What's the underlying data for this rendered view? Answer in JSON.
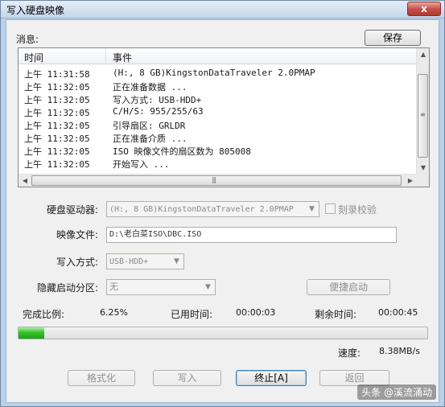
{
  "window": {
    "title": "写入硬盘映像",
    "close_glyph": "x"
  },
  "messages": {
    "label": "消息:",
    "save_label": "保存",
    "columns": [
      "时间",
      "事件"
    ],
    "rows": [
      {
        "time": "上午 11:31:58",
        "event": "(H:, 8 GB)KingstonDataTraveler 2.0PMAP"
      },
      {
        "time": "上午 11:32:05",
        "event": "正在准备数据 ..."
      },
      {
        "time": "上午 11:32:05",
        "event": "写入方式: USB-HDD+"
      },
      {
        "time": "上午 11:32:05",
        "event": "C/H/S: 955/255/63"
      },
      {
        "time": "上午 11:32:05",
        "event": "引导扇区: GRLDR"
      },
      {
        "time": "上午 11:32:05",
        "event": "正在准备介质 ..."
      },
      {
        "time": "上午 11:32:05",
        "event": "ISO 映像文件的扇区数为 805008"
      },
      {
        "time": "上午 11:32:05",
        "event": "开始写入 ..."
      }
    ]
  },
  "form": {
    "drive_label": "硬盘驱动器:",
    "drive_value": "(H:, 8 GB)KingstonDataTraveler 2.0PMAP",
    "verify_label": "刻录校验",
    "image_label": "映像文件:",
    "image_value": "D:\\老白菜ISO\\DBC.ISO",
    "write_mode_label": "写入方式:",
    "write_mode_value": "USB-HDD+",
    "hidden_part_label": "隐藏启动分区:",
    "hidden_part_value": "无",
    "quick_boot_label": "便捷启动"
  },
  "status": {
    "percent_label": "完成比例:",
    "percent_value": "6.25%",
    "progress_fraction": 0.0625,
    "elapsed_label": "已用时间:",
    "elapsed_value": "00:00:03",
    "remaining_label": "剩余时间:",
    "remaining_value": "00:00:45",
    "speed_label": "速度:",
    "speed_value": "8.38MB/s"
  },
  "buttons": {
    "format": "格式化",
    "write": "写入",
    "stop": "终止[A]",
    "back": "返回"
  },
  "watermark": "头条 @溪流涌动",
  "colors": {
    "progress": "#37c22c",
    "frame": "#b9d1ea"
  }
}
